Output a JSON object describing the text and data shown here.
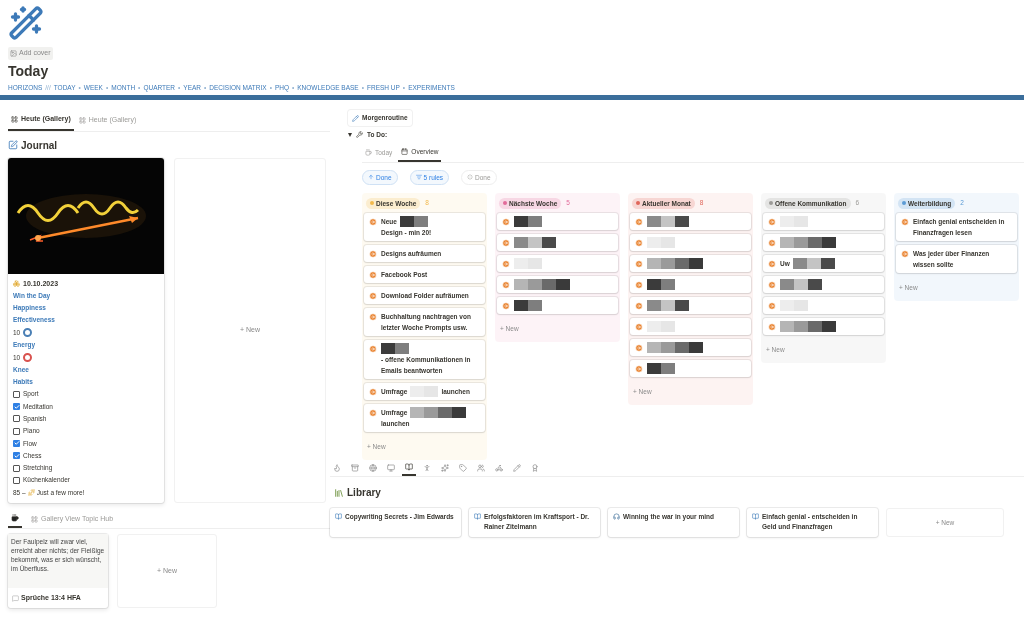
{
  "page": {
    "add_cover": "Add cover",
    "title": "Today"
  },
  "nav": [
    {
      "kind": "link",
      "label": "HORIZONS"
    },
    {
      "kind": "sep",
      "label": "///"
    },
    {
      "kind": "link",
      "label": "TODAY"
    },
    {
      "kind": "sep",
      "label": "•"
    },
    {
      "kind": "link",
      "label": "WEEK"
    },
    {
      "kind": "sep",
      "label": "•"
    },
    {
      "kind": "link",
      "label": "MONTH"
    },
    {
      "kind": "sep",
      "label": "•"
    },
    {
      "kind": "link",
      "label": "QUARTER"
    },
    {
      "kind": "sep",
      "label": "•"
    },
    {
      "kind": "link",
      "label": "YEAR"
    },
    {
      "kind": "sep",
      "label": "•"
    },
    {
      "kind": "link",
      "label": "DECISION MATRIX"
    },
    {
      "kind": "sep",
      "label": "•"
    },
    {
      "kind": "link",
      "label": "PHQ"
    },
    {
      "kind": "sep",
      "label": "•"
    },
    {
      "kind": "link",
      "label": "KNOWLEDGE BASE"
    },
    {
      "kind": "sep",
      "label": "•"
    },
    {
      "kind": "link",
      "label": "FRESH UP"
    },
    {
      "kind": "sep",
      "label": "•"
    },
    {
      "kind": "link",
      "label": "EXPERIMENTS"
    }
  ],
  "journal": {
    "tabs": [
      {
        "label": "Heute (Gallery)",
        "selected": true
      },
      {
        "label": "Heute (Gallery)",
        "selected": false
      }
    ],
    "heading": "Journal",
    "card": {
      "date": "10.10.2023",
      "rows": [
        {
          "kind": "label",
          "text": "Win the Day"
        },
        {
          "kind": "label",
          "text": "Happiness"
        },
        {
          "kind": "label",
          "text": "Effectiveness"
        },
        {
          "kind": "rating",
          "text": "10",
          "color": "#4a7fb5"
        },
        {
          "kind": "label",
          "text": "Energy"
        },
        {
          "kind": "rating",
          "text": "10",
          "color": "#d9534f"
        },
        {
          "kind": "label",
          "text": "Knee"
        },
        {
          "kind": "label",
          "text": "Habits"
        },
        {
          "kind": "checkbox",
          "text": "Sport",
          "checked": false
        },
        {
          "kind": "checkbox",
          "text": "Meditation",
          "checked": true
        },
        {
          "kind": "checkbox",
          "text": "Spanish",
          "checked": false
        },
        {
          "kind": "checkbox",
          "text": "Piano",
          "checked": false
        },
        {
          "kind": "checkbox",
          "text": "Flow",
          "checked": true
        },
        {
          "kind": "checkbox",
          "text": "Chess",
          "checked": true
        },
        {
          "kind": "checkbox",
          "text": "Stretching",
          "checked": false
        },
        {
          "kind": "checkbox",
          "text": "Küchenkalender",
          "checked": false
        },
        {
          "kind": "footer",
          "text": "85 –",
          "note": "Just a few more!"
        }
      ]
    },
    "new": "+ New"
  },
  "topic_hub": {
    "tabs": [
      {
        "selected": true
      },
      {
        "label": "Gallery View Topic Hub",
        "selected": false
      }
    ],
    "card": {
      "quote": "Der Faulpelz will zwar viel, erreicht aber nichts; der Fleißige bekommt, was er sich wünscht, im Überfluss.",
      "source": "Sprüche 13:4 HFA"
    },
    "new": "+ New"
  },
  "routine": {
    "button": "Morgenroutine",
    "toggle": "To Do:",
    "expanded": true,
    "tabs": [
      {
        "label": "Today",
        "selected": false
      },
      {
        "label": "Overview",
        "selected": true
      }
    ],
    "filters": [
      {
        "label": "Done",
        "active": true
      },
      {
        "label": "5 rules",
        "active": true
      },
      {
        "label": "Done",
        "active": false
      }
    ]
  },
  "board": [
    {
      "name": "Diese Woche",
      "count": "8",
      "color": "#f2b94b",
      "new": "+ New",
      "cards": [
        {
          "parts": [
            {
              "kind": "text",
              "text": "Neue"
            },
            {
              "kind": "redacted"
            },
            {
              "kind": "text",
              "text": "Design - min 20!"
            }
          ]
        },
        {
          "parts": [
            {
              "kind": "text",
              "text": "Designs aufräumen"
            }
          ]
        },
        {
          "parts": [
            {
              "kind": "text",
              "text": "Facebook Post"
            }
          ]
        },
        {
          "parts": [
            {
              "kind": "text",
              "text": "Download Folder aufräumen"
            }
          ]
        },
        {
          "parts": [
            {
              "kind": "text",
              "text": "Buchhaltung nachtragen von letzter Woche Prompts usw."
            }
          ]
        },
        {
          "parts": [
            {
              "kind": "redacted"
            },
            {
              "kind": "text",
              "text": "- offene Kommunikationen in Emails beantworten"
            }
          ]
        },
        {
          "parts": [
            {
              "kind": "text",
              "text": "Umfrage"
            },
            {
              "kind": "redacted"
            },
            {
              "kind": "text",
              "text": "launchen"
            }
          ]
        },
        {
          "parts": [
            {
              "kind": "text",
              "text": "Umfrage"
            },
            {
              "kind": "redacted"
            },
            {
              "kind": "text",
              "text": "launchen"
            }
          ]
        }
      ]
    },
    {
      "name": "Nächste Woche",
      "count": "5",
      "color": "#e26b9a",
      "new": "+ New",
      "cards": [
        {
          "parts": [
            {
              "kind": "redacted"
            }
          ]
        },
        {
          "parts": [
            {
              "kind": "redacted"
            }
          ]
        },
        {
          "parts": [
            {
              "kind": "redacted"
            }
          ]
        },
        {
          "parts": [
            {
              "kind": "redacted"
            }
          ]
        },
        {
          "parts": [
            {
              "kind": "redacted"
            }
          ]
        }
      ]
    },
    {
      "name": "Aktueller Monat",
      "count": "8",
      "color": "#e0665a",
      "new": "+ New",
      "cards": [
        {
          "parts": [
            {
              "kind": "redacted"
            }
          ]
        },
        {
          "parts": [
            {
              "kind": "redacted"
            }
          ]
        },
        {
          "parts": [
            {
              "kind": "redacted"
            }
          ]
        },
        {
          "parts": [
            {
              "kind": "redacted"
            }
          ]
        },
        {
          "parts": [
            {
              "kind": "redacted"
            }
          ]
        },
        {
          "parts": [
            {
              "kind": "redacted"
            }
          ]
        },
        {
          "parts": [
            {
              "kind": "redacted"
            }
          ]
        },
        {
          "parts": [
            {
              "kind": "redacted"
            }
          ]
        }
      ]
    },
    {
      "name": "Offene Kommunikation",
      "count": "6",
      "color": "#9b9a97",
      "new": "+ New",
      "cards": [
        {
          "parts": [
            {
              "kind": "redacted"
            }
          ]
        },
        {
          "parts": [
            {
              "kind": "redacted"
            }
          ]
        },
        {
          "parts": [
            {
              "kind": "text",
              "text": "Uw"
            },
            {
              "kind": "redacted"
            }
          ]
        },
        {
          "parts": [
            {
              "kind": "redacted"
            }
          ]
        },
        {
          "parts": [
            {
              "kind": "redacted"
            }
          ]
        },
        {
          "parts": [
            {
              "kind": "redacted"
            }
          ]
        }
      ]
    },
    {
      "name": "Weiterbildung",
      "count": "2",
      "color": "#5b9bd5",
      "new": "+ New",
      "cards": [
        {
          "parts": [
            {
              "kind": "text",
              "text": "Einfach genial entscheiden in Finanzfragen lesen"
            }
          ]
        },
        {
          "parts": [
            {
              "kind": "text",
              "text": "Was jeder über Finanzen wissen sollte"
            }
          ]
        }
      ]
    }
  ],
  "icon_tabs": [
    {
      "selected": false
    },
    {
      "selected": false
    },
    {
      "selected": false
    },
    {
      "selected": false
    },
    {
      "selected": true
    },
    {
      "selected": false
    },
    {
      "selected": false
    },
    {
      "selected": false
    },
    {
      "selected": false
    },
    {
      "selected": false
    },
    {
      "selected": false
    },
    {
      "selected": false
    }
  ],
  "library": {
    "heading": "Library",
    "items": [
      {
        "kind": "book",
        "title": "Copywriting Secrets - Jim Edwards"
      },
      {
        "kind": "book",
        "title": "Erfolgsfaktoren im Kraftsport - Dr. Rainer Zitelmann"
      },
      {
        "kind": "audio",
        "title": "Winning the war in your mind"
      },
      {
        "kind": "book",
        "title": "Einfach genial - entscheiden in Geld und Finanzfragen"
      }
    ],
    "new": "+ New"
  }
}
